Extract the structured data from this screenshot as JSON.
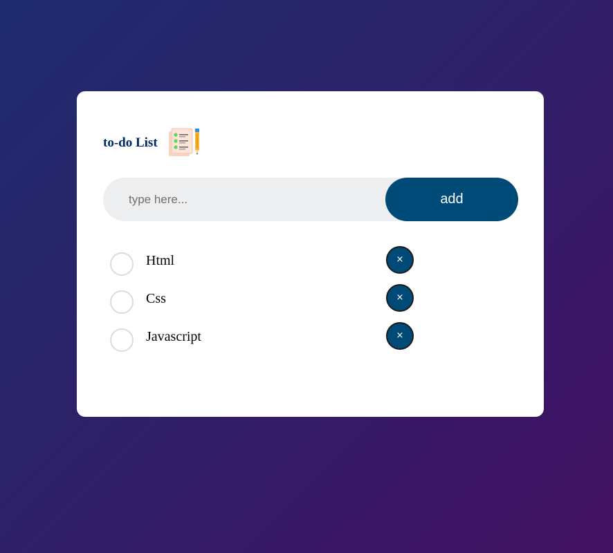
{
  "app": {
    "title": "to-do List",
    "logo_icon": "checklist-notepad-pencil-icon"
  },
  "input": {
    "placeholder": "type here...",
    "value": ""
  },
  "add_button": {
    "label": "add"
  },
  "tasks": [
    {
      "label": "Html",
      "checked": false
    },
    {
      "label": "Css",
      "checked": false
    },
    {
      "label": "Javascript",
      "checked": false
    }
  ],
  "remove_button": {
    "glyph": "×"
  },
  "colors": {
    "accent": "#004a77",
    "title": "#002765",
    "input_bg": "#edeef0",
    "background_start": "#1f2b6e",
    "background_end": "#431260"
  }
}
